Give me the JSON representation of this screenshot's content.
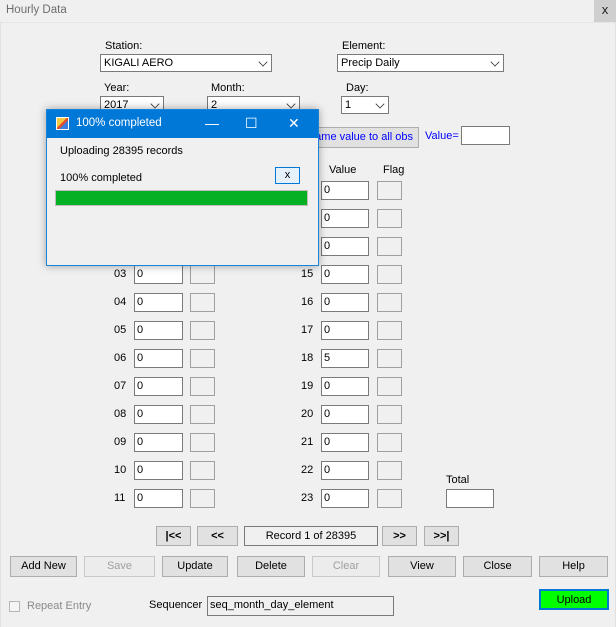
{
  "window": {
    "title": "Hourly Data",
    "close_glyph": "x"
  },
  "header": {
    "station_label": "Station:",
    "station_value": "KIGALI AERO",
    "element_label": "Element:",
    "element_value": "Precip  Daily",
    "year_label": "Year:",
    "year_value": "2017",
    "month_label": "Month:",
    "month_value": "2",
    "day_label": "Day:",
    "day_value": "1",
    "same_value_button": "Same value to all obs",
    "value_label": "Value=",
    "value_field": ""
  },
  "columns": {
    "value": "Value",
    "flag": "Flag"
  },
  "left_rows": [
    {
      "hour": "03",
      "value": "0"
    },
    {
      "hour": "04",
      "value": "0"
    },
    {
      "hour": "05",
      "value": "0"
    },
    {
      "hour": "06",
      "value": "0"
    },
    {
      "hour": "07",
      "value": "0"
    },
    {
      "hour": "08",
      "value": "0"
    },
    {
      "hour": "09",
      "value": "0"
    },
    {
      "hour": "10",
      "value": "0"
    },
    {
      "hour": "11",
      "value": "0"
    }
  ],
  "right_top_values": [
    "0",
    "0",
    "0"
  ],
  "right_rows": [
    {
      "hour": "15",
      "value": "0"
    },
    {
      "hour": "16",
      "value": "0"
    },
    {
      "hour": "17",
      "value": "0"
    },
    {
      "hour": "18",
      "value": "5"
    },
    {
      "hour": "19",
      "value": "0"
    },
    {
      "hour": "20",
      "value": "0"
    },
    {
      "hour": "21",
      "value": "0"
    },
    {
      "hour": "22",
      "value": "0"
    },
    {
      "hour": "23",
      "value": "0"
    }
  ],
  "total": {
    "label": "Total",
    "value": ""
  },
  "navigation": {
    "first": "|<<",
    "prev": "<<",
    "record": "Record 1 of 28395",
    "next": ">>",
    "last": ">>|"
  },
  "actions": {
    "add_new": "Add New",
    "save": "Save",
    "update": "Update",
    "delete": "Delete",
    "clear": "Clear",
    "view": "View",
    "close": "Close",
    "help": "Help",
    "upload": "Upload"
  },
  "footer": {
    "repeat_entry": "Repeat Entry",
    "sequencer_label": "Sequencer",
    "sequencer_value": "seq_month_day_element"
  },
  "progress_dialog": {
    "title": "100% completed",
    "minimize_glyph": "—",
    "maximize_glyph": "☐",
    "close_glyph": "✕",
    "message": "Uploading 28395 records",
    "status": "100% completed",
    "cancel_button": "x",
    "progress": 1.0
  },
  "colors": {
    "progress_fill": "#06b025",
    "dialog_caption": "#0078d7",
    "upload_button": "#00ff00",
    "blue_link_text": "#0000ff"
  }
}
